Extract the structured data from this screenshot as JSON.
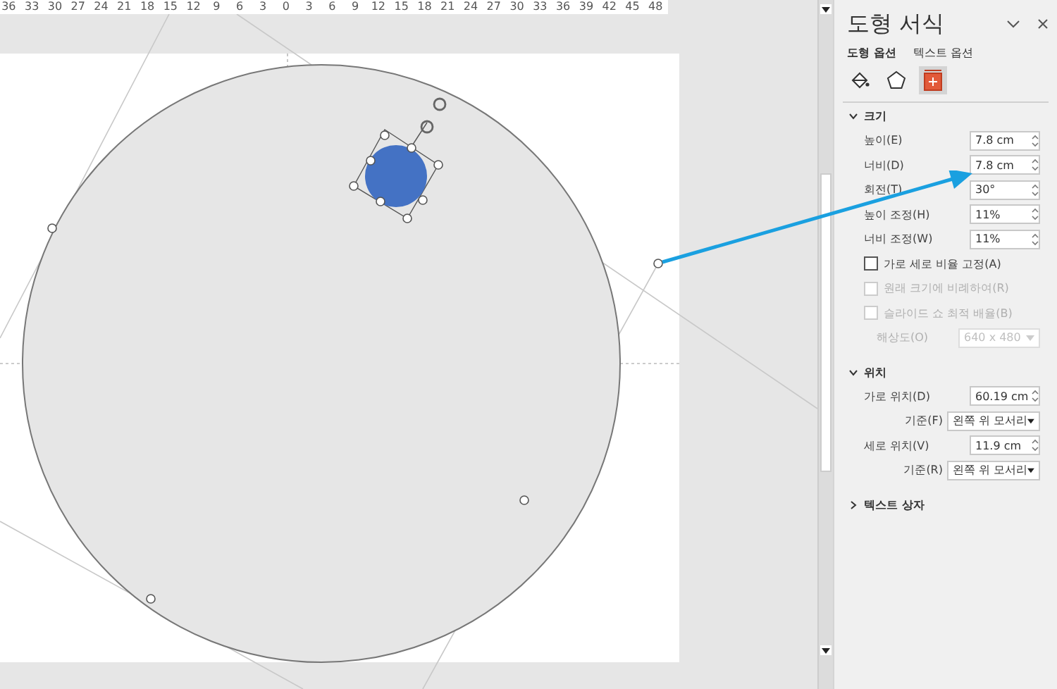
{
  "ruler": {
    "labels": [
      "36",
      "33",
      "30",
      "27",
      "24",
      "21",
      "18",
      "15",
      "12",
      "9",
      "6",
      "3",
      "0",
      "3",
      "6",
      "9",
      "12",
      "15",
      "18",
      "21",
      "24",
      "27",
      "30",
      "33",
      "36",
      "39",
      "42",
      "45",
      "48"
    ]
  },
  "panel": {
    "title": "도형 서식",
    "tabs": [
      {
        "label": "도형 옵션",
        "selected": true
      },
      {
        "label": "텍스트 옵션",
        "selected": false
      }
    ],
    "icon_tabs": [
      {
        "kind": "fill",
        "selected": false
      },
      {
        "kind": "effects",
        "selected": false
      },
      {
        "kind": "size",
        "selected": true
      }
    ],
    "sections": [
      {
        "title": "크기",
        "expanded": true,
        "rows": [
          {
            "kind": "spin",
            "label": "높이(E)",
            "value": "7.8 cm",
            "disabled": false
          },
          {
            "kind": "spin",
            "label": "너비(D)",
            "value": "7.8 cm",
            "disabled": false
          },
          {
            "kind": "spin",
            "label": "회전(T)",
            "value": "30°",
            "disabled": false
          },
          {
            "kind": "spin",
            "label": "높이 조정(H)",
            "value": "11%",
            "disabled": false
          },
          {
            "kind": "spin",
            "label": "너비 조정(W)",
            "value": "11%",
            "disabled": false
          },
          {
            "kind": "checkbox",
            "label": "가로 세로 비율 고정(A)",
            "checked": false,
            "disabled": false
          },
          {
            "kind": "checkbox",
            "label": "원래 크기에 비례하여(R)",
            "checked": false,
            "disabled": true
          },
          {
            "kind": "checkbox",
            "label": "슬라이드 쇼 최적 배율(B)",
            "checked": false,
            "disabled": true
          },
          {
            "kind": "dropdown",
            "label": "해상도(O)",
            "value": "640 x 480",
            "disabled": true
          }
        ]
      },
      {
        "title": "위치",
        "expanded": true,
        "rows": [
          {
            "kind": "spin",
            "label": "가로 위치(D)",
            "value": "60.19 cm",
            "disabled": false
          },
          {
            "kind": "anchor",
            "label": "기준(F)",
            "value": "왼쪽 위 모서리",
            "disabled": false
          },
          {
            "kind": "spin",
            "label": "세로 위치(V)",
            "value": "11.9 cm",
            "disabled": false
          },
          {
            "kind": "anchor",
            "label": "기준(R)",
            "value": "왼쪽 위 모서리",
            "disabled": false
          }
        ]
      },
      {
        "title": "텍스트 상자",
        "expanded": false
      }
    ]
  }
}
